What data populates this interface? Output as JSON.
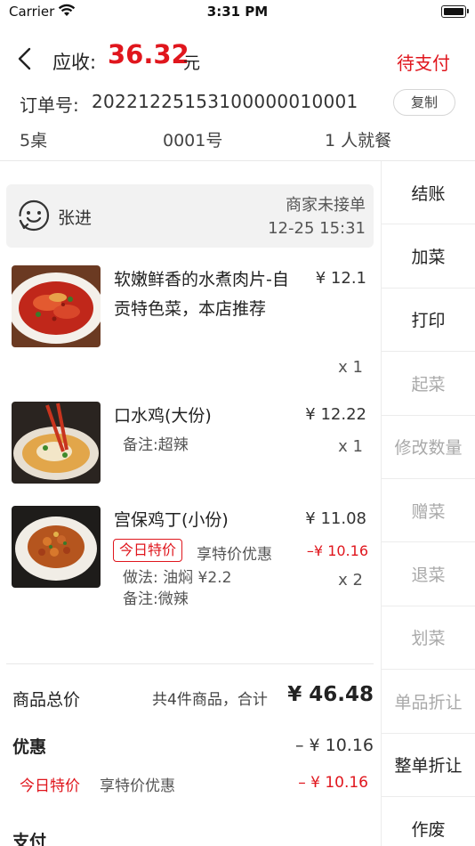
{
  "status_bar": {
    "carrier": "Carrier",
    "time": "3:31 PM"
  },
  "header": {
    "amount_label": "应收:",
    "amount_value": "36.32",
    "amount_unit": "元",
    "pay_status": "待支付",
    "order_no_label": "订单号:",
    "order_no": "20221225153100000010001",
    "copy_label": "复制",
    "table": "5桌",
    "serial": "0001号",
    "diners": "1 人就餐"
  },
  "customer": {
    "name": "张进",
    "state": "商家未接单",
    "time": "12-25 15:31"
  },
  "dishes": [
    {
      "name": "软嫩鲜香的水煮肉片-自贡特色菜，本店推荐",
      "price": "¥ 12.1",
      "qty": "x 1"
    },
    {
      "name": "口水鸡(大份)",
      "price": "¥ 12.22",
      "qty": "x 1",
      "note": "备注:超辣"
    },
    {
      "name": "宫保鸡丁(小份)",
      "price": "¥ 11.08",
      "qty": "x 2",
      "promo_tag": "今日特价",
      "promo_desc": "享特价优惠",
      "promo_discount": "–¥ 10.16",
      "method": "做法: 油焖 ¥2.2",
      "note": "备注:微辣"
    }
  ],
  "summary": {
    "label": "商品总价",
    "count": "共4件商品，合计",
    "total": "¥ 46.48",
    "discount_label": "优惠",
    "discount_value": "– ¥ 10.16",
    "discount_tag": "今日特价",
    "discount_desc": "享特价优惠",
    "discount_amount": "– ¥ 10.16",
    "pay_label": "支付"
  },
  "actions": [
    {
      "label": "结账",
      "enabled": true
    },
    {
      "label": "加菜",
      "enabled": true
    },
    {
      "label": "打印",
      "enabled": true
    },
    {
      "label": "起菜",
      "enabled": false
    },
    {
      "label": "修改数量",
      "enabled": false
    },
    {
      "label": "赠菜",
      "enabled": false
    },
    {
      "label": "退菜",
      "enabled": false
    },
    {
      "label": "划菜",
      "enabled": false
    },
    {
      "label": "单品折让",
      "enabled": false
    },
    {
      "label": "整单折让",
      "enabled": true
    },
    {
      "label": "作废",
      "enabled": true
    }
  ],
  "colors": {
    "accent": "#e0161d",
    "disabled": "#a9a9a9"
  },
  "icons": [
    "back-chevron-icon",
    "wifi-icon",
    "battery-icon",
    "smile-face-icon"
  ]
}
